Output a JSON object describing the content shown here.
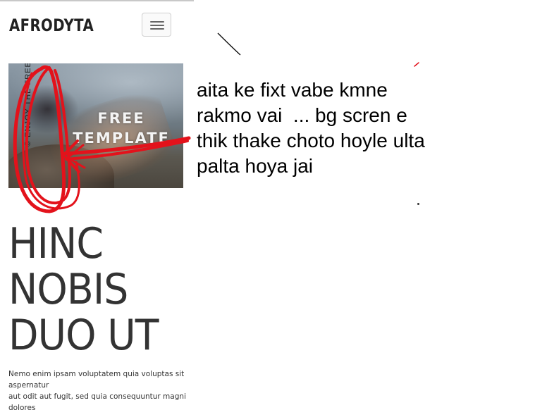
{
  "navbar": {
    "brand": "AFRODYTA",
    "menu_icon": "hamburger-menu-icon"
  },
  "hero": {
    "title_line1": "FREE",
    "title_line2": "TEMPLATE",
    "credit": "© ENJOY THE FREE"
  },
  "headline": {
    "lines": [
      "HINC",
      "NOBIS",
      "DUO UT"
    ]
  },
  "body_copy": {
    "lines": [
      "Nemo enim ipsam voluptatem quia voluptas sit",
      "aspernatur",
      "aut odit aut fugit, sed quia consequuntur magni",
      "dolores"
    ]
  },
  "annotation": {
    "lines": [
      "aita ke fixt vabe kmne",
      "rakmo vai  ... bg scren e",
      "thik thake choto hoyle ulta",
      "palta hoya jai"
    ],
    "scribble_color": "#e3121b"
  },
  "colors": {
    "background": "#ffffff",
    "text_dark": "#333333",
    "brand": "#222222"
  }
}
